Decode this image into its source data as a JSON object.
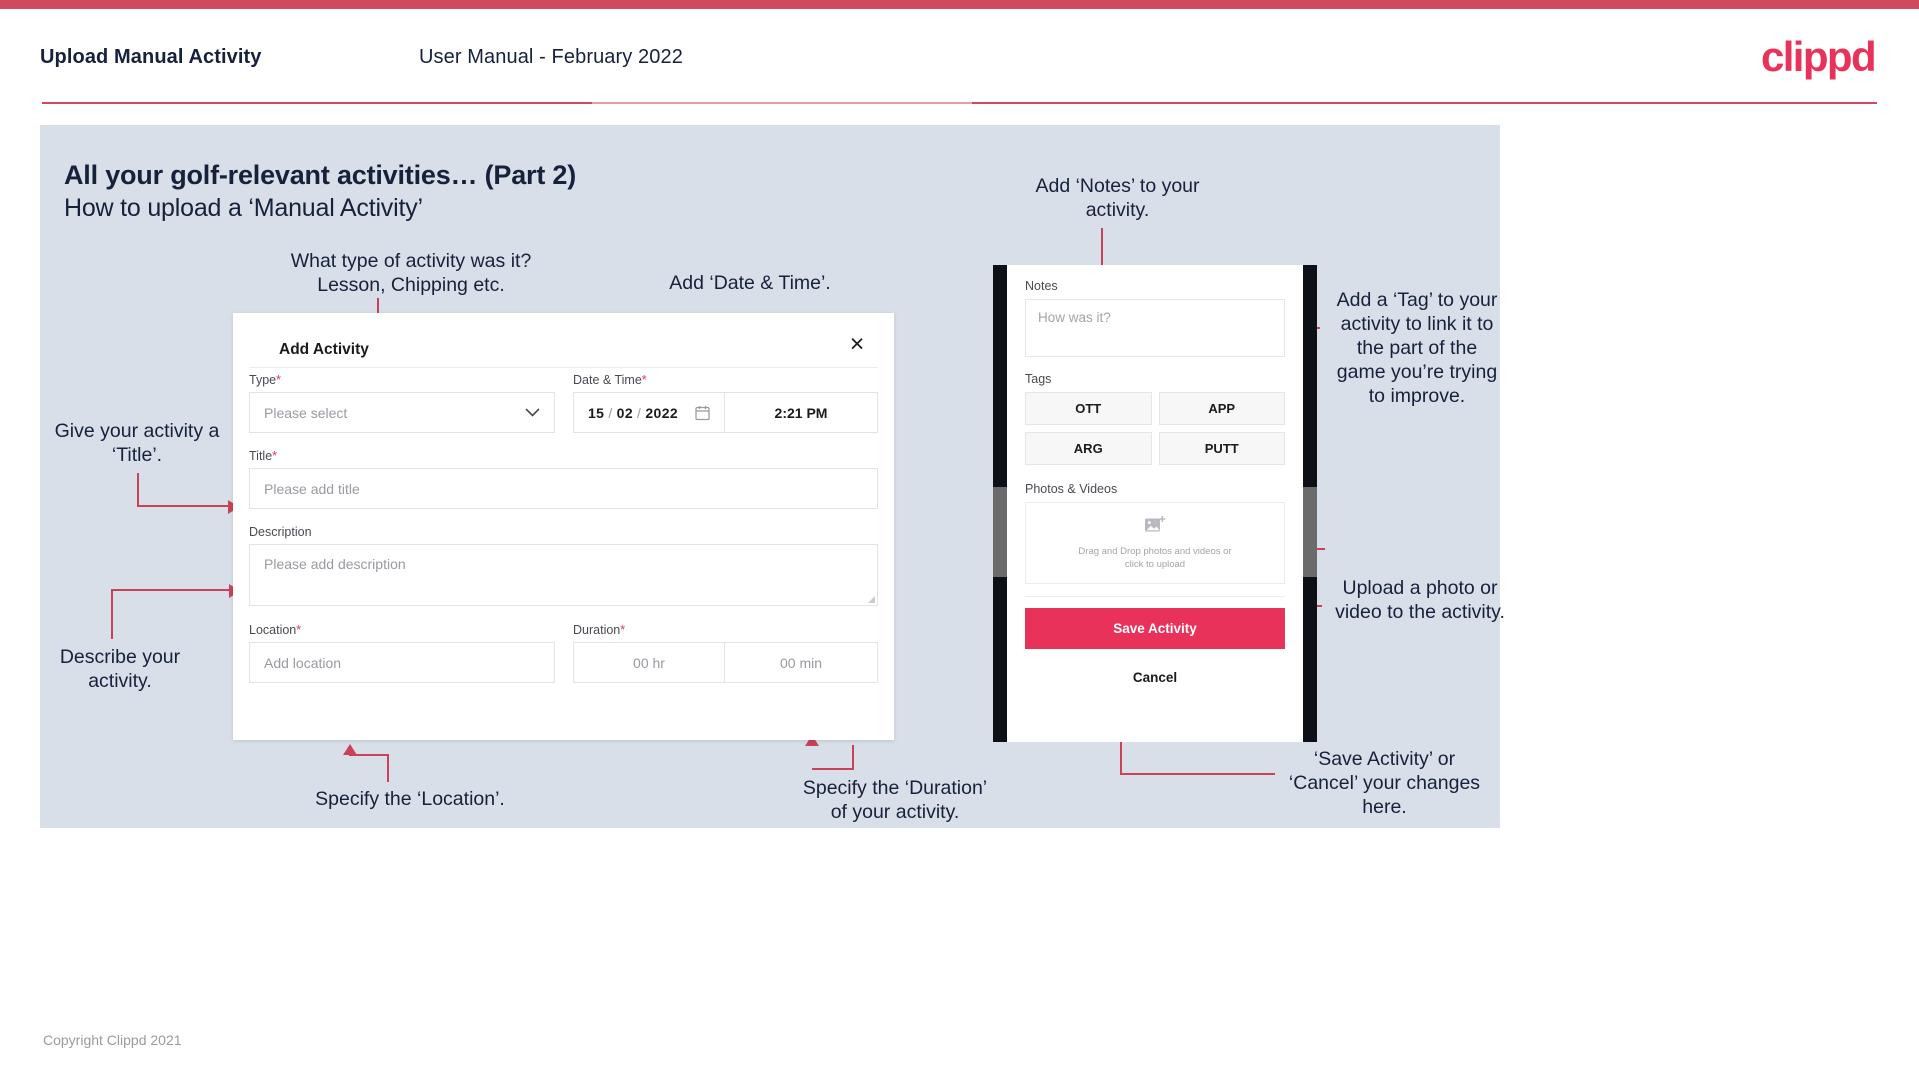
{
  "header": {
    "title": "Upload Manual Activity",
    "subtitle": "User Manual - February 2022",
    "logo": "clippd"
  },
  "slide": {
    "title": "All your golf-relevant activities… (Part 2)",
    "subtitle": "How to upload a ‘Manual Activity’"
  },
  "dialog": {
    "title": "Add Activity",
    "close_icon": "×",
    "fields": {
      "type": {
        "label": "Type",
        "required": "*",
        "placeholder": "Please select"
      },
      "datetime": {
        "label": "Date & Time",
        "required": "*",
        "day": "15",
        "month": "02",
        "year": "2022",
        "sep": "/",
        "time": "2:21 PM"
      },
      "title": {
        "label": "Title",
        "required": "*",
        "placeholder": "Please add title"
      },
      "description": {
        "label": "Description",
        "placeholder": "Please add description"
      },
      "location": {
        "label": "Location",
        "required": "*",
        "placeholder": "Add location"
      },
      "duration": {
        "label": "Duration",
        "required": "*",
        "hours": "00 hr",
        "minutes": "00 min"
      }
    }
  },
  "phone": {
    "notes_label": "Notes",
    "notes_placeholder": "How was it?",
    "tags_label": "Tags",
    "tags": [
      "OTT",
      "APP",
      "ARG",
      "PUTT"
    ],
    "photos_label": "Photos & Videos",
    "dropzone_line1": "Drag and Drop photos and videos or",
    "dropzone_line2": "click to upload",
    "save_label": "Save Activity",
    "cancel_label": "Cancel"
  },
  "annotations": {
    "type": "What type of activity was it?\nLesson, Chipping etc.",
    "datetime": "Add ‘Date & Time’.",
    "title": "Give your activity a\n‘Title’.",
    "description": "Describe your\nactivity.",
    "location": "Specify the ‘Location’.",
    "duration": "Specify the ‘Duration’\nof your activity.",
    "notes": "Add ‘Notes’ to your\nactivity.",
    "tags": "Add a ‘Tag’ to your\nactivity to link it to\nthe part of the\ngame you’re trying\nto improve.",
    "upload": "Upload a photo or\nvideo to the activity.",
    "save": "‘Save Activity’ or\n‘Cancel’ your changes\nhere."
  },
  "footer": {
    "copyright": "Copyright Clippd 2021"
  },
  "colors": {
    "accent": "#e8325a",
    "rule": "#cf4a5e",
    "panel_bg": "#d9dfe8",
    "text_dark": "#16213c",
    "connector": "#c94259"
  }
}
